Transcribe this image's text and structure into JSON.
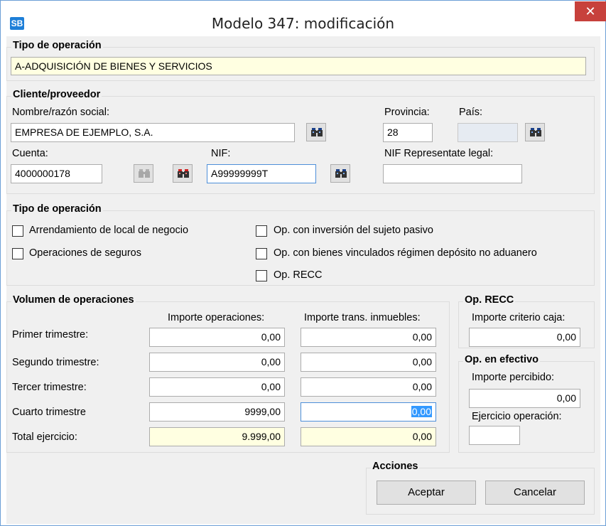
{
  "window": {
    "app_icon_text": "SB",
    "title": "Modelo 347: modificación",
    "close_glyph": "✕"
  },
  "tipo_operacion_top": {
    "title": "Tipo de operación",
    "value": "A-ADQUISICIÓN DE BIENES Y SERVICIOS"
  },
  "cliente": {
    "title": "Cliente/proveedor",
    "nombre_label": "Nombre/razón social:",
    "nombre_value": "EMPRESA DE EJEMPLO, S.A.",
    "provincia_label": "Provincia:",
    "provincia_value": "28",
    "pais_label": "País:",
    "pais_value": "",
    "cuenta_label": "Cuenta:",
    "cuenta_value": "4000000178",
    "nif_label": "NIF:",
    "nif_value": "A99999999T",
    "nif_rep_label": "NIF Representate legal:",
    "nif_rep_value": ""
  },
  "tipo_operacion_checks": {
    "title": "Tipo de operación",
    "arrendamiento": "Arrendamiento de local de negocio",
    "seguros": "Operaciones de seguros",
    "inversion": "Op. con inversión del sujeto pasivo",
    "deposito": "Op. con bienes vinculados régimen depósito no aduanero",
    "recc": "Op. RECC"
  },
  "volumen": {
    "title": "Volumen de operaciones",
    "col_importe": "Importe operaciones:",
    "col_inmuebles": "Importe trans. inmuebles:",
    "rows": [
      {
        "label": "Primer trimestre:",
        "importe": "0,00",
        "inmuebles": "0,00"
      },
      {
        "label": "Segundo trimestre:",
        "importe": "0,00",
        "inmuebles": "0,00"
      },
      {
        "label": "Tercer trimestre:",
        "importe": "0,00",
        "inmuebles": "0,00"
      },
      {
        "label": "Cuarto trimestre",
        "importe": "9999,00",
        "inmuebles": "0,00"
      },
      {
        "label": "Total ejercicio:",
        "importe": "9.999,00",
        "inmuebles": "0,00"
      }
    ]
  },
  "op_recc": {
    "title": "Op. RECC",
    "label": "Importe criterio caja:",
    "value": "0,00"
  },
  "op_efectivo": {
    "title": "Op. en efectivo",
    "percibido_label": "Importe percibido:",
    "percibido_value": "0,00",
    "ejercicio_label": "Ejercicio operación:",
    "ejercicio_value": ""
  },
  "acciones": {
    "title": "Acciones",
    "aceptar": "Aceptar",
    "cancelar": "Cancelar"
  },
  "icons": {
    "lookup": "binoculars-icon",
    "lookup_edit": "binoculars-red-icon",
    "close": "close-icon"
  },
  "colors": {
    "yellow_field": "#ffffe1",
    "close_red": "#c7413c",
    "app_blue": "#1e7fd8",
    "selection": "#3399ff"
  }
}
